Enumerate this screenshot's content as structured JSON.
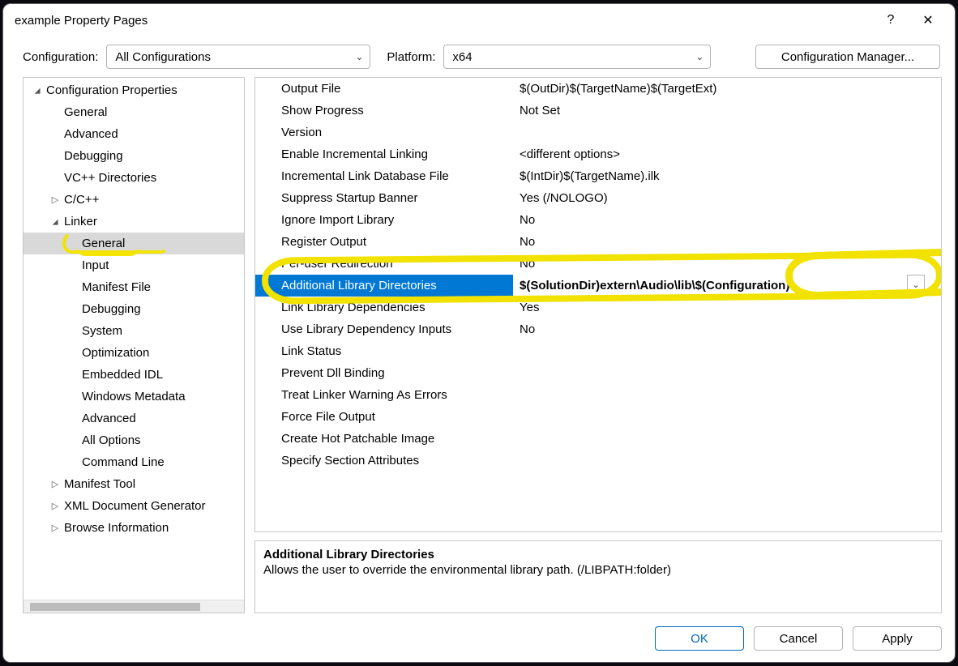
{
  "title": "example Property Pages",
  "toolbar": {
    "configLabel": "Configuration:",
    "configValue": "All Configurations",
    "platformLabel": "Platform:",
    "platformValue": "x64",
    "managerLabel": "Configuration Manager..."
  },
  "tree": [
    {
      "label": "Configuration Properties",
      "indent": 0,
      "twisty": "▢?",
      "glyph": "◢"
    },
    {
      "label": "General",
      "indent": 1
    },
    {
      "label": "Advanced",
      "indent": 1
    },
    {
      "label": "Debugging",
      "indent": 1
    },
    {
      "label": "VC++ Directories",
      "indent": 1
    },
    {
      "label": "C/C++",
      "indent": 1,
      "glyph": "▷"
    },
    {
      "label": "Linker",
      "indent": 1,
      "glyph": "◢"
    },
    {
      "label": "General",
      "indent": 2,
      "selected": true,
      "scribble": true
    },
    {
      "label": "Input",
      "indent": 2
    },
    {
      "label": "Manifest File",
      "indent": 2
    },
    {
      "label": "Debugging",
      "indent": 2
    },
    {
      "label": "System",
      "indent": 2
    },
    {
      "label": "Optimization",
      "indent": 2
    },
    {
      "label": "Embedded IDL",
      "indent": 2
    },
    {
      "label": "Windows Metadata",
      "indent": 2
    },
    {
      "label": "Advanced",
      "indent": 2
    },
    {
      "label": "All Options",
      "indent": 2
    },
    {
      "label": "Command Line",
      "indent": 2
    },
    {
      "label": "Manifest Tool",
      "indent": 1,
      "glyph": "▷"
    },
    {
      "label": "XML Document Generator",
      "indent": 1,
      "glyph": "▷"
    },
    {
      "label": "Browse Information",
      "indent": 1,
      "glyph": "▷"
    }
  ],
  "grid": [
    {
      "name": "Output File",
      "value": "$(OutDir)$(TargetName)$(TargetExt)"
    },
    {
      "name": "Show Progress",
      "value": "Not Set"
    },
    {
      "name": "Version",
      "value": ""
    },
    {
      "name": "Enable Incremental Linking",
      "value": "<different options>"
    },
    {
      "name": "Incremental Link Database File",
      "value": "$(IntDir)$(TargetName).ilk"
    },
    {
      "name": "Suppress Startup Banner",
      "value": "Yes (/NOLOGO)"
    },
    {
      "name": "Ignore Import Library",
      "value": "No"
    },
    {
      "name": "Register Output",
      "value": "No"
    },
    {
      "name": "Per-user Redirection",
      "value": "No"
    },
    {
      "name": "Additional Library Directories",
      "value": "$(SolutionDir)extern\\Audio\\lib\\$(Configuration)",
      "selected": true
    },
    {
      "name": "Link Library Dependencies",
      "value": "Yes"
    },
    {
      "name": "Use Library Dependency Inputs",
      "value": "No"
    },
    {
      "name": "Link Status",
      "value": ""
    },
    {
      "name": "Prevent Dll Binding",
      "value": ""
    },
    {
      "name": "Treat Linker Warning As Errors",
      "value": ""
    },
    {
      "name": "Force File Output",
      "value": ""
    },
    {
      "name": "Create Hot Patchable Image",
      "value": ""
    },
    {
      "name": "Specify Section Attributes",
      "value": ""
    }
  ],
  "description": {
    "title": "Additional Library Directories",
    "body": "Allows the user to override the environmental library path. (/LIBPATH:folder)"
  },
  "footer": {
    "ok": "OK",
    "cancel": "Cancel",
    "apply": "Apply"
  },
  "glyphs": {
    "help": "?",
    "close": "✕",
    "chevdown": "⌄"
  }
}
